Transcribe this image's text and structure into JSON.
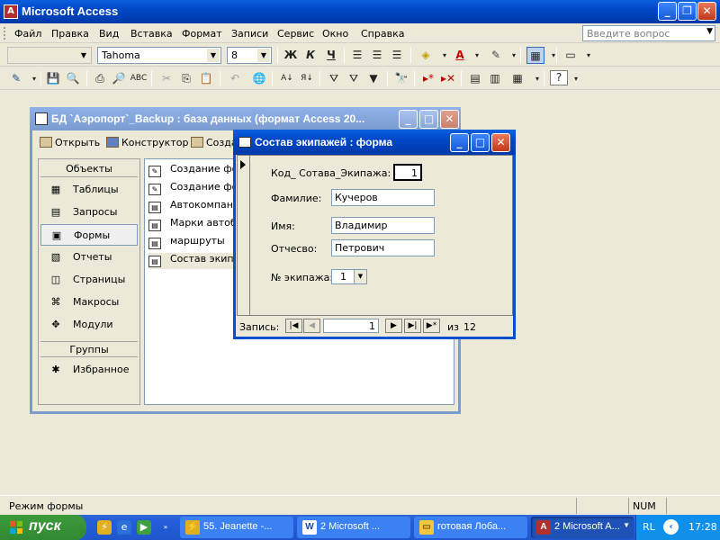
{
  "app": {
    "title": "Microsoft Access"
  },
  "menu": {
    "items": [
      "Файл",
      "Правка",
      "Вид",
      "Вставка",
      "Формат",
      "Записи",
      "Сервис",
      "Окно",
      "Справка"
    ],
    "help_placeholder": "Введите вопрос"
  },
  "format_toolbar": {
    "font": "Tahoma",
    "size": "8",
    "bold": "Ж",
    "italic": "К",
    "underline": "Ч"
  },
  "db_window": {
    "title": "БД `Аэропорт`_Backup : база данных (формат Access 20...",
    "tools": [
      "Открыть",
      "Конструктор",
      "Создать"
    ],
    "objects_header": "Объекты",
    "objects": [
      {
        "label": "Таблицы",
        "icon": "table-icon"
      },
      {
        "label": "Запросы",
        "icon": "query-icon"
      },
      {
        "label": "Формы",
        "icon": "form-icon"
      },
      {
        "label": "Отчеты",
        "icon": "report-icon"
      },
      {
        "label": "Страницы",
        "icon": "page-icon"
      },
      {
        "label": "Макросы",
        "icon": "macro-icon"
      },
      {
        "label": "Модули",
        "icon": "module-icon"
      }
    ],
    "groups_header": "Группы",
    "groups": [
      {
        "label": "Избранное",
        "icon": "favorites-icon"
      }
    ],
    "list": [
      "Создание фо",
      "Создание фо",
      "Автокомпани",
      "Марки автоб",
      "маршруты",
      "Состав экипа"
    ]
  },
  "form_window": {
    "title": "Состав экипажей : форма",
    "fields": {
      "crew_id_label": "Код_ Сотава_Экипажа:",
      "crew_id_value": "1",
      "surname_label": "Фамилие:",
      "surname_value": "Кучеров",
      "name_label": "Имя:",
      "name_value": "Владимир",
      "patronymic_label": "Отчесво:",
      "patronymic_value": "Петрович",
      "crew_no_label": "№ экипажа:",
      "crew_no_value": "1"
    },
    "nav": {
      "label": "Запись:",
      "current": "1",
      "of_label": "из",
      "total": "12"
    }
  },
  "statusbar": {
    "mode": "Режим формы",
    "num": "NUM"
  },
  "taskbar": {
    "start": "пуск",
    "tasks": [
      {
        "label": "55. Jeanette -...",
        "icon": "winamp-icon"
      },
      {
        "label": "2 Microsoft ...",
        "icon": "word-icon"
      },
      {
        "label": "готовая Лоба...",
        "icon": "folder-icon"
      },
      {
        "label": "2 Microsoft A...",
        "icon": "access-icon"
      }
    ],
    "lang": "RL",
    "clock": "17:28"
  }
}
